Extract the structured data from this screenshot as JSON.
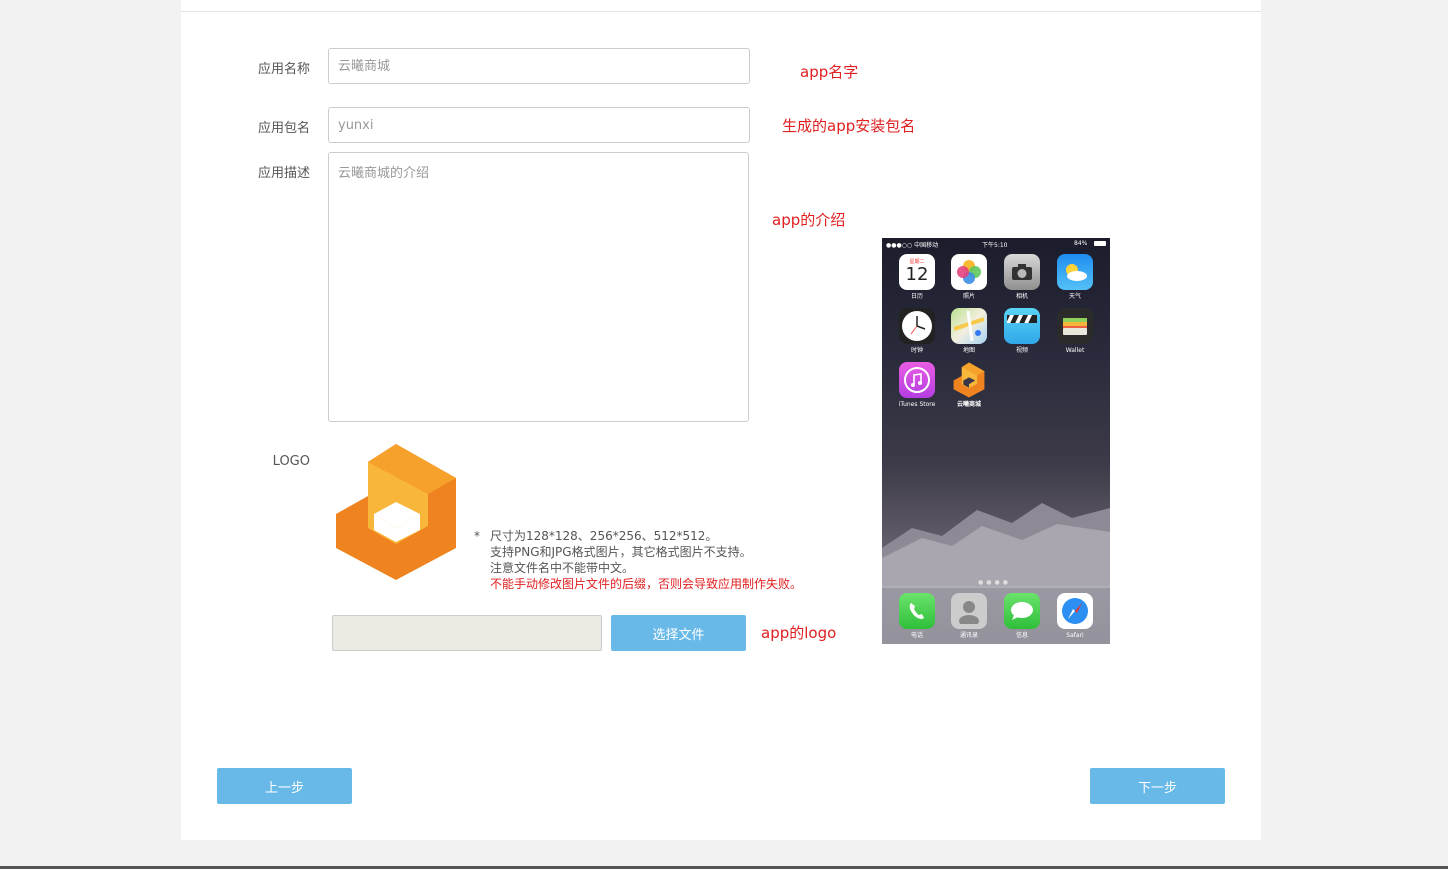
{
  "form": {
    "name_label": "应用名称",
    "name_placeholder": "云曦商城",
    "package_label": "应用包名",
    "package_placeholder": "yunxi",
    "desc_label": "应用描述",
    "desc_placeholder": "云曦商城的介绍",
    "logo_label": "LOGO"
  },
  "notes": {
    "name_note": "app名字",
    "package_note": "生成的app安装包名",
    "desc_note": "app的介绍",
    "logo_note": "app的logo"
  },
  "tips": {
    "star": "*",
    "line1": "尺寸为128*128、256*256、512*512。",
    "line2": "支持PNG和JPG格式图片，其它格式图片不支持。",
    "line3": "注意文件名中不能带中文。",
    "line4": "不能手动修改图片文件的后缀，否则会导致应用制作失败。"
  },
  "buttons": {
    "choose_file": "选择文件",
    "prev": "上一步",
    "next": "下一步"
  },
  "phone": {
    "carrier": "●●●○○ 中国移动",
    "time": "下午5:10",
    "battery": "84%",
    "apps": [
      {
        "name": "日历",
        "icon": "calendar-icon",
        "date_top": "星期二",
        "date_num": "12"
      },
      {
        "name": "照片",
        "icon": "photos-icon"
      },
      {
        "name": "相机",
        "icon": "camera-icon"
      },
      {
        "name": "天气",
        "icon": "weather-icon"
      },
      {
        "name": "时钟",
        "icon": "clock-icon"
      },
      {
        "name": "地图",
        "icon": "maps-icon"
      },
      {
        "name": "视频",
        "icon": "videos-icon"
      },
      {
        "name": "Wallet",
        "icon": "wallet-icon"
      },
      {
        "name": "iTunes Store",
        "icon": "itunes-icon"
      },
      {
        "name": "云曦商城",
        "icon": "yunxi-logo-icon"
      }
    ],
    "dock": [
      {
        "name": "电话",
        "icon": "phone-icon"
      },
      {
        "name": "通讯录",
        "icon": "contacts-icon"
      },
      {
        "name": "信息",
        "icon": "messages-icon"
      },
      {
        "name": "Safari",
        "icon": "safari-icon"
      }
    ]
  },
  "colors": {
    "accent": "#69b9e8",
    "note_red": "#e02020",
    "logo_orange": "#ee8320",
    "logo_yellow": "#f8b63a"
  }
}
